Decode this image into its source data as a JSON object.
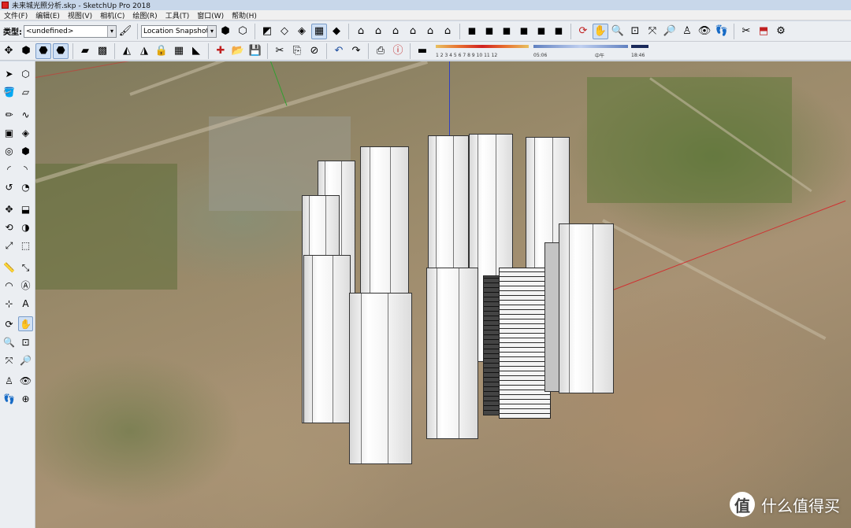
{
  "window": {
    "title": "未来城光照分析.skp - SketchUp Pro 2018"
  },
  "menu": [
    {
      "label": "文件(F)"
    },
    {
      "label": "编辑(E)"
    },
    {
      "label": "视图(V)"
    },
    {
      "label": "相机(C)"
    },
    {
      "label": "绘图(R)"
    },
    {
      "label": "工具(T)"
    },
    {
      "label": "窗口(W)"
    },
    {
      "label": "帮助(H)"
    }
  ],
  "toolbar": {
    "type_label": "类型:",
    "type_value": "<undefined>",
    "location_snapshot": "Location Snapshot",
    "shadow": {
      "months": "1 2 3 4 5 6 7 8 9 10 11 12",
      "start_time": "05:06",
      "noon": "中午",
      "end_time": "18:46"
    }
  },
  "icons": {
    "row1": [
      "material-icon",
      "location-snapshot-icon",
      "iso-view-icon",
      "top-view-icon",
      "front-view-icon",
      "right-view-icon",
      "back-view-icon",
      "left-view-icon",
      "xray-icon",
      "wireframe-icon",
      "hidden-line-icon",
      "shaded-icon",
      "shaded-texture-icon",
      "monochrome-icon",
      "warehouse-icon",
      "house-icon",
      "house-outline-icon",
      "house-front-icon",
      "house-side-icon",
      "components-icon",
      "styles-icon",
      "layers-icon",
      "scenes-icon",
      "materials-icon",
      "orbit-icon",
      "pan-icon",
      "zoom-icon",
      "zoom-window-icon",
      "zoom-extents-icon",
      "previous-view-icon",
      "position-camera-icon",
      "look-around-icon",
      "walk-icon",
      "section-plane-icon",
      "extension-warehouse-icon"
    ],
    "row2": [
      "move-axes-icon",
      "iso-small-icon",
      "standard-view-icon",
      "perspective-icon",
      "terrain-icon",
      "photo-texture-icon",
      "add-location-icon",
      "toggle-terrain-icon",
      "lock-icon",
      "grid-icon",
      "geo-icon",
      "new-icon",
      "open-icon",
      "save-icon",
      "cut-icon",
      "copy-icon",
      "erase-icon",
      "undo-icon",
      "redo-icon",
      "print-icon",
      "model-info-icon",
      "shadow-toggle-icon"
    ]
  },
  "colors": {
    "title_bar": "#c8d7ea",
    "toolbar_bg": "#ebeef2",
    "axis_red": "#d03030",
    "axis_green": "#30a030",
    "axis_blue": "#3040c0"
  },
  "watermark": {
    "logo_char": "值",
    "text": "什么值得买"
  }
}
